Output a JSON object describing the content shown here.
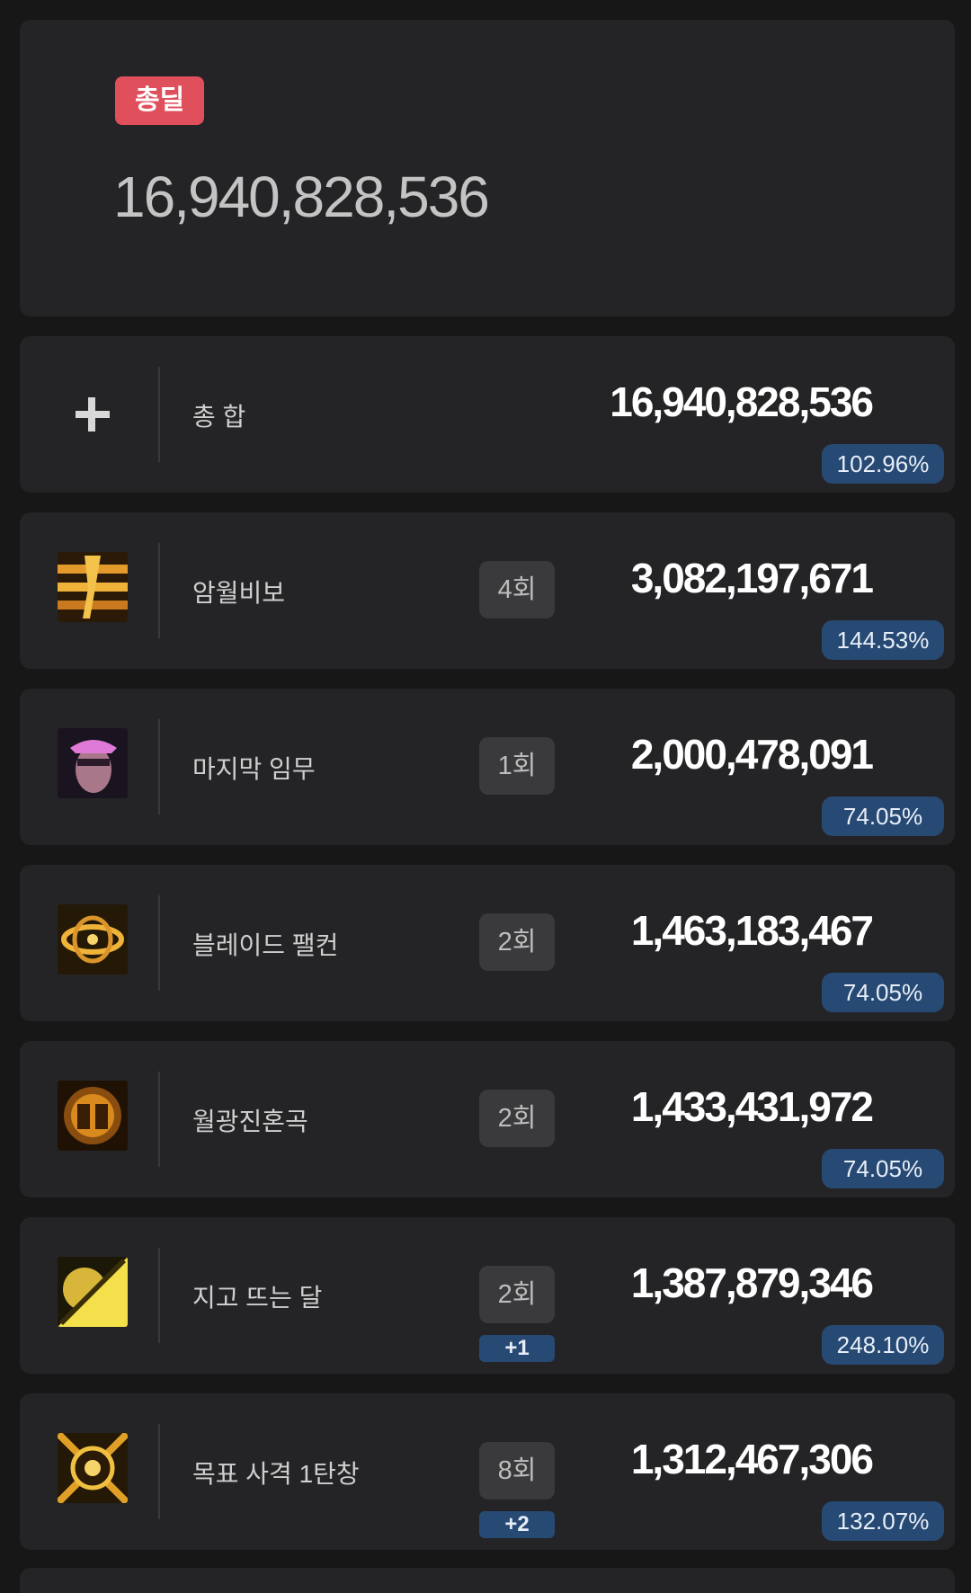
{
  "summary": {
    "badge": "총딜",
    "total": "16,940,828,536"
  },
  "total_row": {
    "name": "총 합",
    "value": "16,940,828,536",
    "percent": "102.96%",
    "icon": "plus-icon"
  },
  "skills": [
    {
      "name": "암월비보",
      "count": "4회",
      "extra": "",
      "value": "3,082,197,671",
      "percent": "144.53%",
      "icon": "dark-moon-secret-icon"
    },
    {
      "name": "마지막 임무",
      "count": "1회",
      "extra": "",
      "value": "2,000,478,091",
      "percent": "74.05%",
      "icon": "last-mission-icon"
    },
    {
      "name": "블레이드 팰컨",
      "count": "2회",
      "extra": "",
      "value": "1,463,183,467",
      "percent": "74.05%",
      "icon": "blade-falcon-icon"
    },
    {
      "name": "월광진혼곡",
      "count": "2회",
      "extra": "",
      "value": "1,433,431,972",
      "percent": "74.05%",
      "icon": "moonlight-requiem-icon"
    },
    {
      "name": "지고 뜨는 달",
      "count": "2회",
      "extra": "+1",
      "value": "1,387,879,346",
      "percent": "248.10%",
      "icon": "setting-rising-moon-icon"
    },
    {
      "name": "목표 사격 1탄창",
      "count": "8회",
      "extra": "+2",
      "value": "1,312,467,306",
      "percent": "132.07%",
      "icon": "target-shot-icon"
    }
  ],
  "colors": {
    "badge": "#e0505c",
    "percent_badge": "#274a74",
    "card": "#242426",
    "background": "#171717"
  }
}
